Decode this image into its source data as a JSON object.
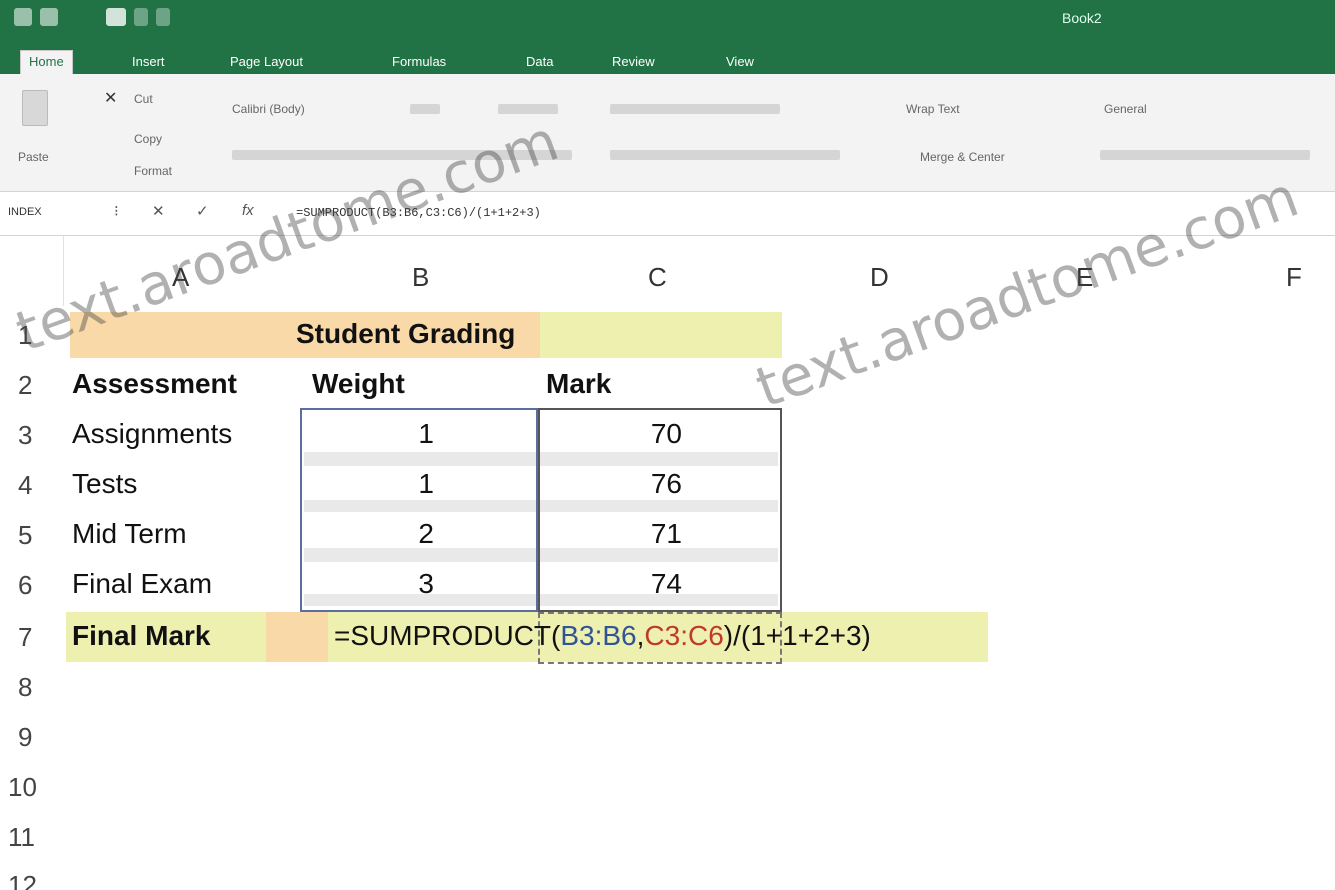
{
  "window": {
    "title": "Book2"
  },
  "ribbon_tabs": [
    "Home",
    "Insert",
    "Page Layout",
    "Formulas",
    "Data",
    "Review",
    "View"
  ],
  "ribbon": {
    "paste_label": "Paste",
    "cut_label": "Cut",
    "copy_label": "Copy",
    "format_painter_label": "Format",
    "font_name": "Calibri (Body)",
    "wrap_text": "Wrap Text",
    "merge_center": "Merge & Center",
    "number_format": "General"
  },
  "formula_bar": {
    "name_box": "INDEX",
    "formula": "=SUMPRODUCT(B3:B6,C3:C6)/(1+1+2+3)"
  },
  "columns": [
    "A",
    "B",
    "C",
    "D",
    "E",
    "F"
  ],
  "rows": [
    "1",
    "2",
    "3",
    "4",
    "5",
    "6",
    "7",
    "8",
    "9",
    "10",
    "11",
    "12"
  ],
  "sheet": {
    "title": "Student Grading",
    "headers": {
      "a": "Assessment",
      "b": "Weight",
      "c": "Mark"
    },
    "data_rows": [
      {
        "assessment": "Assignments",
        "weight": "1",
        "mark": "70"
      },
      {
        "assessment": "Tests",
        "weight": "1",
        "mark": "76"
      },
      {
        "assessment": "Mid Term",
        "weight": "2",
        "mark": "71"
      },
      {
        "assessment": "Final Exam",
        "weight": "3",
        "mark": "74"
      }
    ],
    "final_label": "Final Mark",
    "final_formula": {
      "prefix": "=SUMPRODUCT(",
      "ref1": "B3:B6",
      "comma": ",",
      "ref2": "C3:C6",
      "suffix": ")/(1+1+2+3)"
    }
  },
  "watermark": "text.aroadtome.com",
  "colors": {
    "excel_green": "#217346",
    "highlight_orange": "#f9d9a8",
    "highlight_lime": "#eef0b0",
    "ref_blue": "#2f5597",
    "ref_red": "#c0392b"
  }
}
